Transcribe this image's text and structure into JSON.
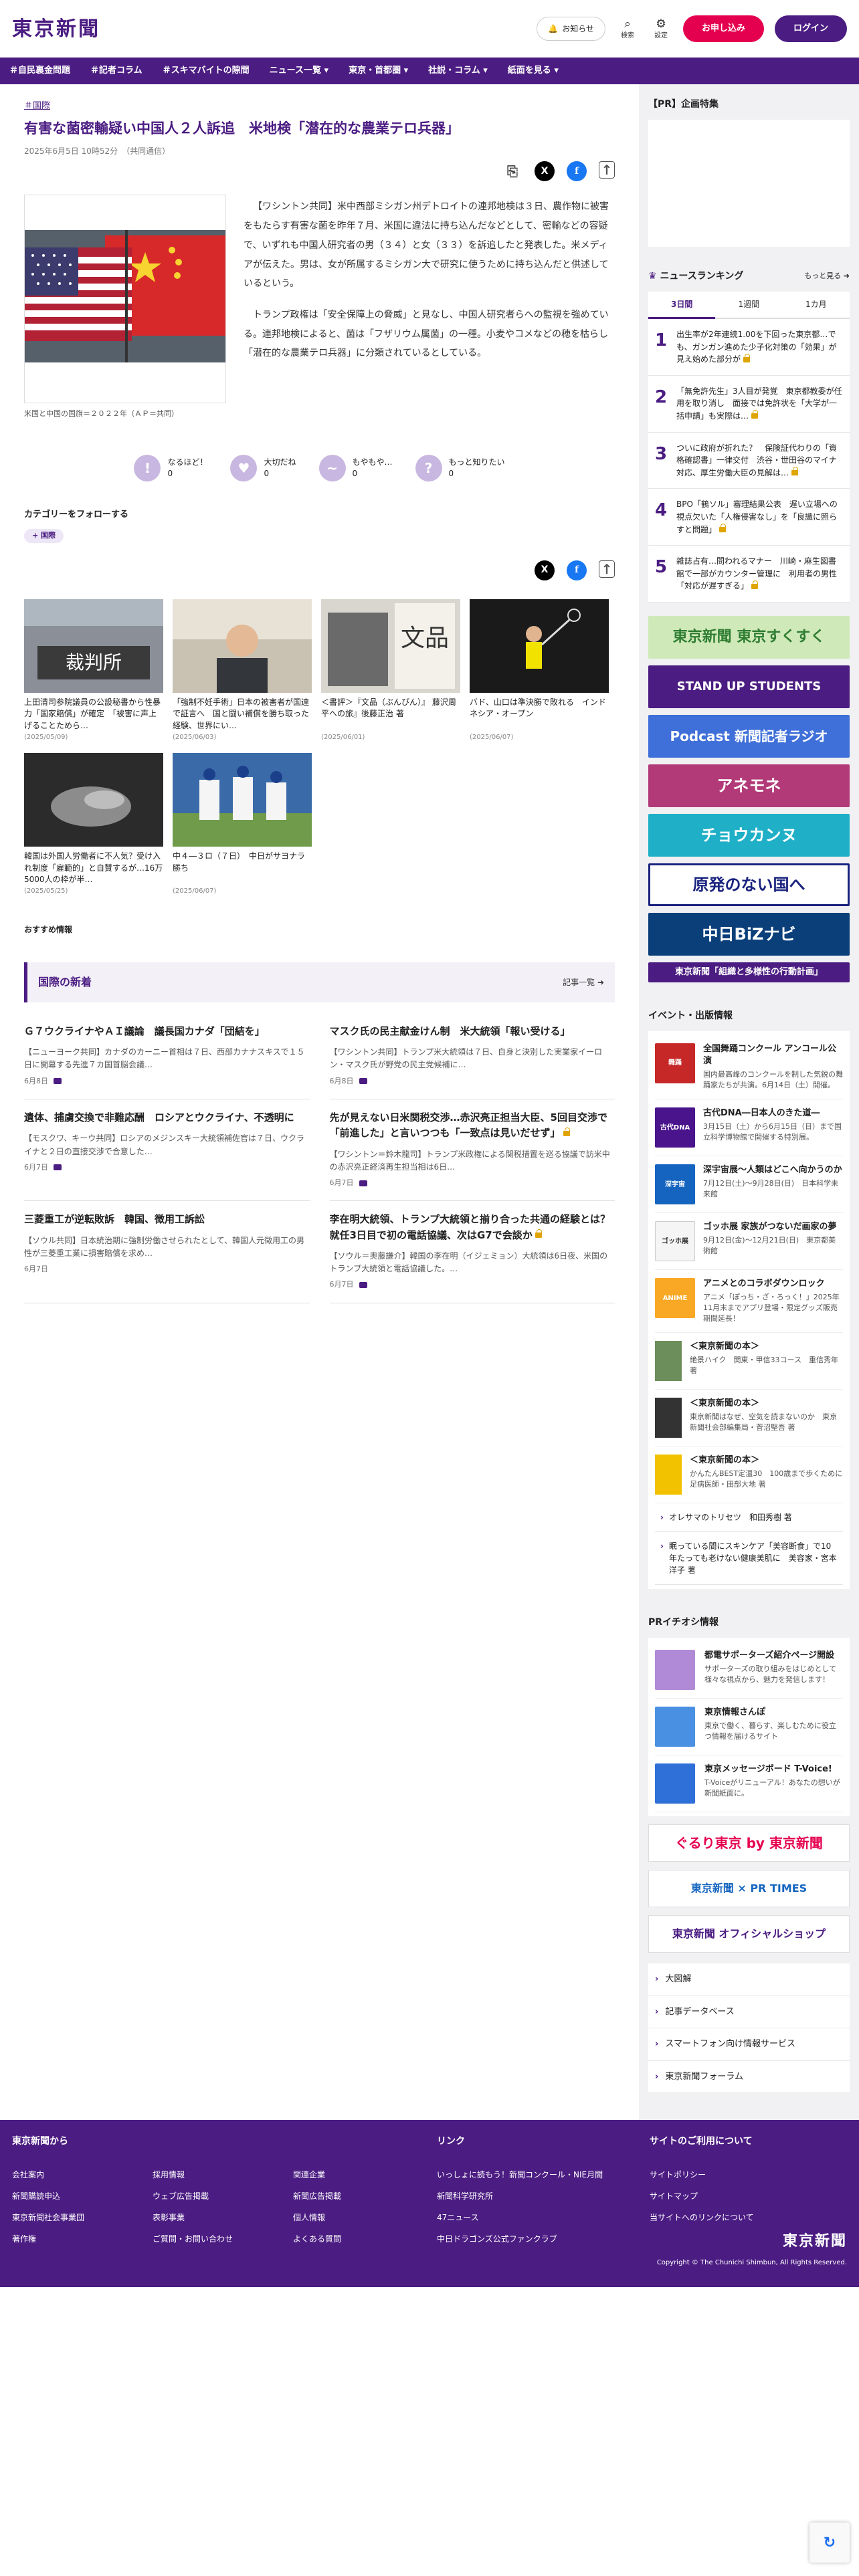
{
  "header": {
    "logo": "東京新聞",
    "notice": "お知らせ",
    "search": "検索",
    "settings": "設定",
    "apply": "お申し込み",
    "login": "ログイン"
  },
  "nav": [
    "＃自民裏金問題",
    "＃記者コラム",
    "＃スキマバイトの隙間",
    "ニュース一覧 ▾",
    "東京・首都圏 ▾",
    "社説・コラム ▾",
    "紙面を見る ▾"
  ],
  "article": {
    "category": "＃国際",
    "title": "有害な菌密輸疑い中国人２人訴追　米地検「潜在的な農業テロ兵器」",
    "date": "2025年6月5日 10時52分　（共同通信）",
    "caption": "米国と中国の国旗＝２０２２年（ＡＰ＝共同）",
    "paragraphs": [
      "【ワシントン共同】米中西部ミシガン州デトロイトの連邦地検は３日、農作物に被害をもたらす有害な菌を昨年７月、米国に違法に持ち込んだなどとして、密輸などの容疑で、いずれも中国人研究者の男（３４）と女（３３）を訴追したと発表した。米メディアが伝えた。男は、女が所属するミシガン大で研究に使うために持ち込んだと供述しているという。",
      "トランプ政権は「安全保障上の脅威」と見なし、中国人研究者らへの監視を強めている。連邦地検によると、菌は「フザリウム属菌」の一種。小麦やコメなどの穂を枯らし「潜在的な農業テロ兵器」に分類されているとしている。"
    ]
  },
  "reactions": [
    {
      "label": "なるほど！",
      "count": "0",
      "face": "!"
    },
    {
      "label": "大切だね",
      "count": "0",
      "face": "♥"
    },
    {
      "label": "もやもや…",
      "count": "0",
      "face": "~"
    },
    {
      "label": "もっと知りたい",
      "count": "0",
      "face": "?"
    }
  ],
  "follow": {
    "title": "カテゴリーをフォローする",
    "chip": "+ 国際"
  },
  "related": [
    {
      "title": "上田清司参院議員の公設秘書から性暴力「国家賠償」が確定　「被害に声上げることためら…",
      "date": "(2025/05/09)",
      "img": "court"
    },
    {
      "title": "「強制不妊手術」日本の被害者が国連で証言へ　国と闘い補償を勝ち取った経験、世界にい…",
      "date": "(2025/06/03)",
      "img": "man"
    },
    {
      "title": "＜書評＞『文品（ぶんぴん）』 藤沢周平への旅』後藤正治 著",
      "date": "(2025/06/01)",
      "img": "book"
    },
    {
      "title": "バド、山口は準決勝で敗れる　インドネシア・オープン",
      "date": "(2025/06/07)",
      "img": "badminton"
    },
    {
      "title": "韓国は外国人労働者に不人気？受け入れ制度「雇範的」と自賛するが…16万5000人の枠が半…",
      "date": "(2025/05/25)",
      "img": "hands"
    },
    {
      "title": "中４―３ロ（７日）　中日がサヨナラ勝ち",
      "date": "(2025/06/07)",
      "img": "baseball"
    }
  ],
  "recommend": "おすすめ情報",
  "category_news": {
    "title": "国際の新着",
    "more": "記事一覧",
    "items": [
      {
        "title": "Ｇ７ウクライナやＡＩ議論　議長国カナダ「団結を」",
        "snippet": "【ニューヨーク共同】カナダのカーニー首相は７日、西部カナナスキスで１５日に開幕する先進７カ国首脳会議…",
        "date": "6月8日",
        "lock": false
      },
      {
        "title": "マスク氏の民主献金けん制　米大統領「報い受ける」",
        "snippet": "【ワシントン共同】トランプ米大統領は７日、自身と決別した実業家イーロン・マスク氏が野党の民主党候補に…",
        "date": "6月8日",
        "lock": false
      },
      {
        "title": "遺体、捕虜交換で非難応酬　ロシアとウクライナ、不透明に",
        "snippet": "【モスクワ、キーウ共同】ロシアのメジンスキー大統領補佐官は７日、ウクライナと２日の直接交渉で合意した…",
        "date": "6月7日",
        "lock": false
      },
      {
        "title": "先が見えない日米関税交渉…赤沢亮正担当大臣、5回目交渉で「前進した」と言いつつも「一致点は見いだせず」",
        "snippet": "【ワシントン＝鈴木龍司】トランプ米政権による関税措置を巡る協議で訪米中の赤沢亮正経済再生担当相は6日…",
        "date": "6月7日",
        "lock": true
      },
      {
        "title": "三菱重工が逆転敗訴　韓国、徴用工訴訟",
        "snippet": "【ソウル共同】日本統治期に強制労働させられたとして、韓国人元徴用工の男性が三菱重工業に損害賠償を求め…",
        "date": "6月7日",
        "lock": false
      },
      {
        "title": "李在明大統領、トランプ大統領と揃り合った共通の経験とは？　就任3日目で初の電話協議、次はG7で会談か",
        "snippet": "【ソウル＝奥藤謙介】韓国の李在明（イジェミョン）大統領は6日夜、米国のトランプ大統領と電話協議した。…",
        "date": "6月7日",
        "lock": true
      }
    ]
  },
  "sidebar": {
    "pr_title": "【PR】企画特集",
    "ranking_title": "ニュースランキング",
    "ranking_more": "もっと見る",
    "ranking_tabs": [
      "3日間",
      "1週間",
      "1カ月"
    ],
    "ranking": [
      {
        "num": "1",
        "text": "出生率が2年連続1.00を下回った東京都…でも、ガンガン進めた少子化対策の「効果」が見え始めた部分が",
        "lock": true
      },
      {
        "num": "2",
        "text": "「無免許先生」3人目が発覚　東京都教委が任用を取り消し　面接では免許状を「大学が一括申請」も実際は…",
        "lock": true
      },
      {
        "num": "3",
        "text": "ついに政府が折れた？　保険証代わりの「資格確認書」一律交付　渋谷・世田谷のマイナ対応、厚生労働大臣の見解は…",
        "lock": true
      },
      {
        "num": "4",
        "text": "BPO「鶴ソル」審理結果公表　遅い立場への視点欠いた「人権侵害なし」を「良識に照らすと問題」",
        "lock": true
      },
      {
        "num": "5",
        "text": "雑誌占有…問われるマナー　川崎・麻生図書館で一部がカウンター管理に　利用者の男性「対応が遅すぎる」",
        "lock": true
      }
    ],
    "banners": [
      {
        "text": "東京新聞 東京すくすく",
        "bg": "#cfe9b8",
        "color": "#2e7d32"
      },
      {
        "text": "STAND UP STUDENTS",
        "bg": "#4b1c82",
        "color": "#ffffff"
      },
      {
        "text": "Podcast 新聞記者ラジオ",
        "bg": "#3f6fd8",
        "color": "#ffffff"
      },
      {
        "text": "アネモネ",
        "bg": "#b23a78",
        "color": "#ffffff"
      },
      {
        "text": "チョウカンヌ",
        "bg": "#1fb0c7",
        "color": "#ffffff"
      },
      {
        "text": "原発のない国へ",
        "bg": "#ffffff",
        "color": "#1a237e"
      },
      {
        "text": "中日BiZナビ",
        "bg": "#0b3f7a",
        "color": "#ffffff"
      },
      {
        "text": "東京新聞「組織と多様性の行動計画」",
        "bg": "#4b1c82",
        "color": "#ffffff"
      }
    ],
    "events_title": "イベント・出版情報",
    "events": [
      {
        "title": "全国舞踊コンクール アンコール公演",
        "sub": "国内最高峰のコンクールを制した気鋭の舞踊家たちが共演。6月14日（土）開催。",
        "bg": "#c62828",
        "label": "舞踊"
      },
      {
        "title": "古代DNA―日本人のきた道―",
        "sub": "3月15日（土）から6月15日（日）まで国立科学博物館で開催する特別展。",
        "bg": "#4a148c",
        "label": "古代DNA"
      },
      {
        "title": "深宇宙展～人類はどこへ向かうのか",
        "sub": "7月12日(土)～9月28日(日)　日本科学未来館",
        "bg": "#1565c0",
        "label": "深宇宙"
      },
      {
        "title": "ゴッホ展 家族がつないだ画家の夢",
        "sub": "9月12日(金)～12月21日(日)　東京都美術館",
        "bg": "#f5f5f5",
        "label": "ゴッホ展"
      },
      {
        "title": "アニメとのコラボダウンロック",
        "sub": "アニメ「ぽっち・ざ・ろっく！」2025年11月末までアプリ登場・限定グッズ販売期間延長！",
        "bg": "#f9a825",
        "label": "ANIME"
      }
    ],
    "books": [
      {
        "title": "＜東京新聞の本＞",
        "sub": "絶景ハイク　関東・甲信33コース　重信秀年 著",
        "bg": "#6b8e5a"
      },
      {
        "title": "＜東京新聞の本＞",
        "sub": "東京新聞はなぜ、空気を読まないのか　東京新聞社会部編集局・菅沼堅吾 著",
        "bg": "#333333"
      },
      {
        "title": "＜東京新聞の本＞",
        "sub": "かんたんBEST定温30　100歳まで歩くために　足病医師・田部大地 著",
        "bg": "#f2c200"
      }
    ],
    "text_links": [
      "オレサマのトリセツ　和田秀樹 著",
      "眠っている間にスキンケア「美容断食」で10年たっても老けない健康美肌に　美容家・宮本洋子 著"
    ],
    "pr_section": "PRイチオシ情報",
    "pr_items": [
      {
        "title": "都電サポーターズ紹介ページ開設",
        "sub": "サポーターズの取り組みをはじめとして様々な視点から、魅力を発信します！",
        "bg": "#b08ad6"
      },
      {
        "title": "東京情報さんぽ",
        "sub": "東京で働く、暮らす、楽しむために役立つ情報を届けるサイト",
        "bg": "#4a90e2"
      },
      {
        "title": "東京メッセージボード T-Voice!",
        "sub": "T-Voiceがリニューアル！あなたの想いが新聞紙面に。",
        "bg": "#2e6fd8"
      }
    ],
    "ad_logos": [
      "ぐるり東京 by 東京新聞",
      "東京新聞 × PR TIMES",
      "東京新聞 オフィシャルショップ"
    ],
    "links": [
      "大図解",
      "記事データベース",
      "スマートフォン向け情報サービス",
      "東京新聞フォーラム"
    ]
  },
  "footer": {
    "col1_title": "東京新聞から",
    "col1": [
      "会社案内",
      "採用情報",
      "関連企業",
      "新聞購読申込",
      "ウェブ広告掲載",
      "新聞広告掲載",
      "東京新聞社会事業団",
      "表彰事業",
      "個人情報",
      "著作権",
      "ご質問・お問い合わせ",
      "よくある質問"
    ],
    "col2_title": "リンク",
    "col2": [
      "いっしょに読もう！新聞コンクール・NIE月間",
      "新聞科学研究所",
      "47ニュース",
      "中日ドラゴンズ公式ファンクラブ"
    ],
    "col3_title": "サイトのご利用について",
    "col3": [
      "サイトポリシー",
      "サイトマップ",
      "当サイトへのリンクについて"
    ],
    "logo": "東京新聞",
    "copyright": "Copyright © The Chunichi Shimbun, All Rights Reserved."
  }
}
